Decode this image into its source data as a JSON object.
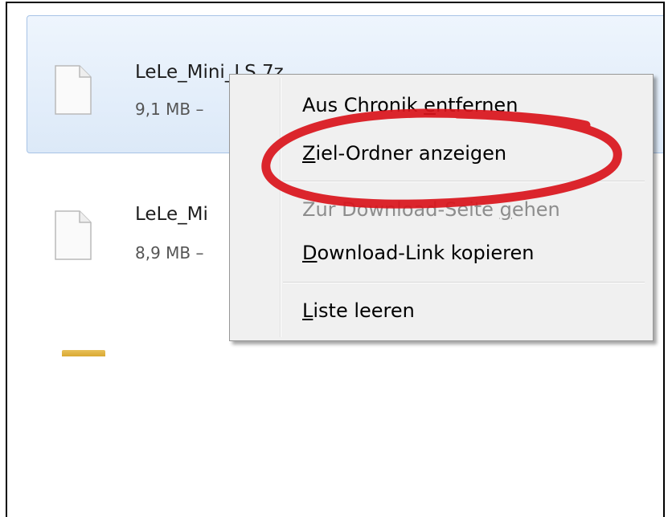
{
  "downloads": [
    {
      "name": "LeLe_Mini_LS.7z",
      "status": "9,1 MB –",
      "selected": true
    },
    {
      "name": "LeLe_Mi",
      "status": "8,9 MB –",
      "selected": false
    }
  ],
  "context_menu": {
    "items": [
      {
        "pre": "Aus Chronik ",
        "accel": "e",
        "post": "ntfernen",
        "enabled": true
      },
      {
        "pre": "",
        "accel": "Z",
        "post": "iel-Ordner anzeigen",
        "enabled": true
      },
      {
        "pre": "Zur Download-Seite ",
        "accel": "g",
        "post": "ehen",
        "enabled": false
      },
      {
        "pre": "",
        "accel": "D",
        "post": "ownload-Link kopieren",
        "enabled": true
      },
      {
        "pre": "",
        "accel": "L",
        "post": "iste leeren",
        "enabled": true
      }
    ]
  },
  "annotation": {
    "target": "Ziel-Ordner anzeigen",
    "color": "#d9141b"
  },
  "colors": {
    "selection_bg": "#dce9f8",
    "selection_border": "#a7c3e6",
    "menu_bg": "#f0f0f0",
    "disabled_text": "#8d8d8d"
  }
}
